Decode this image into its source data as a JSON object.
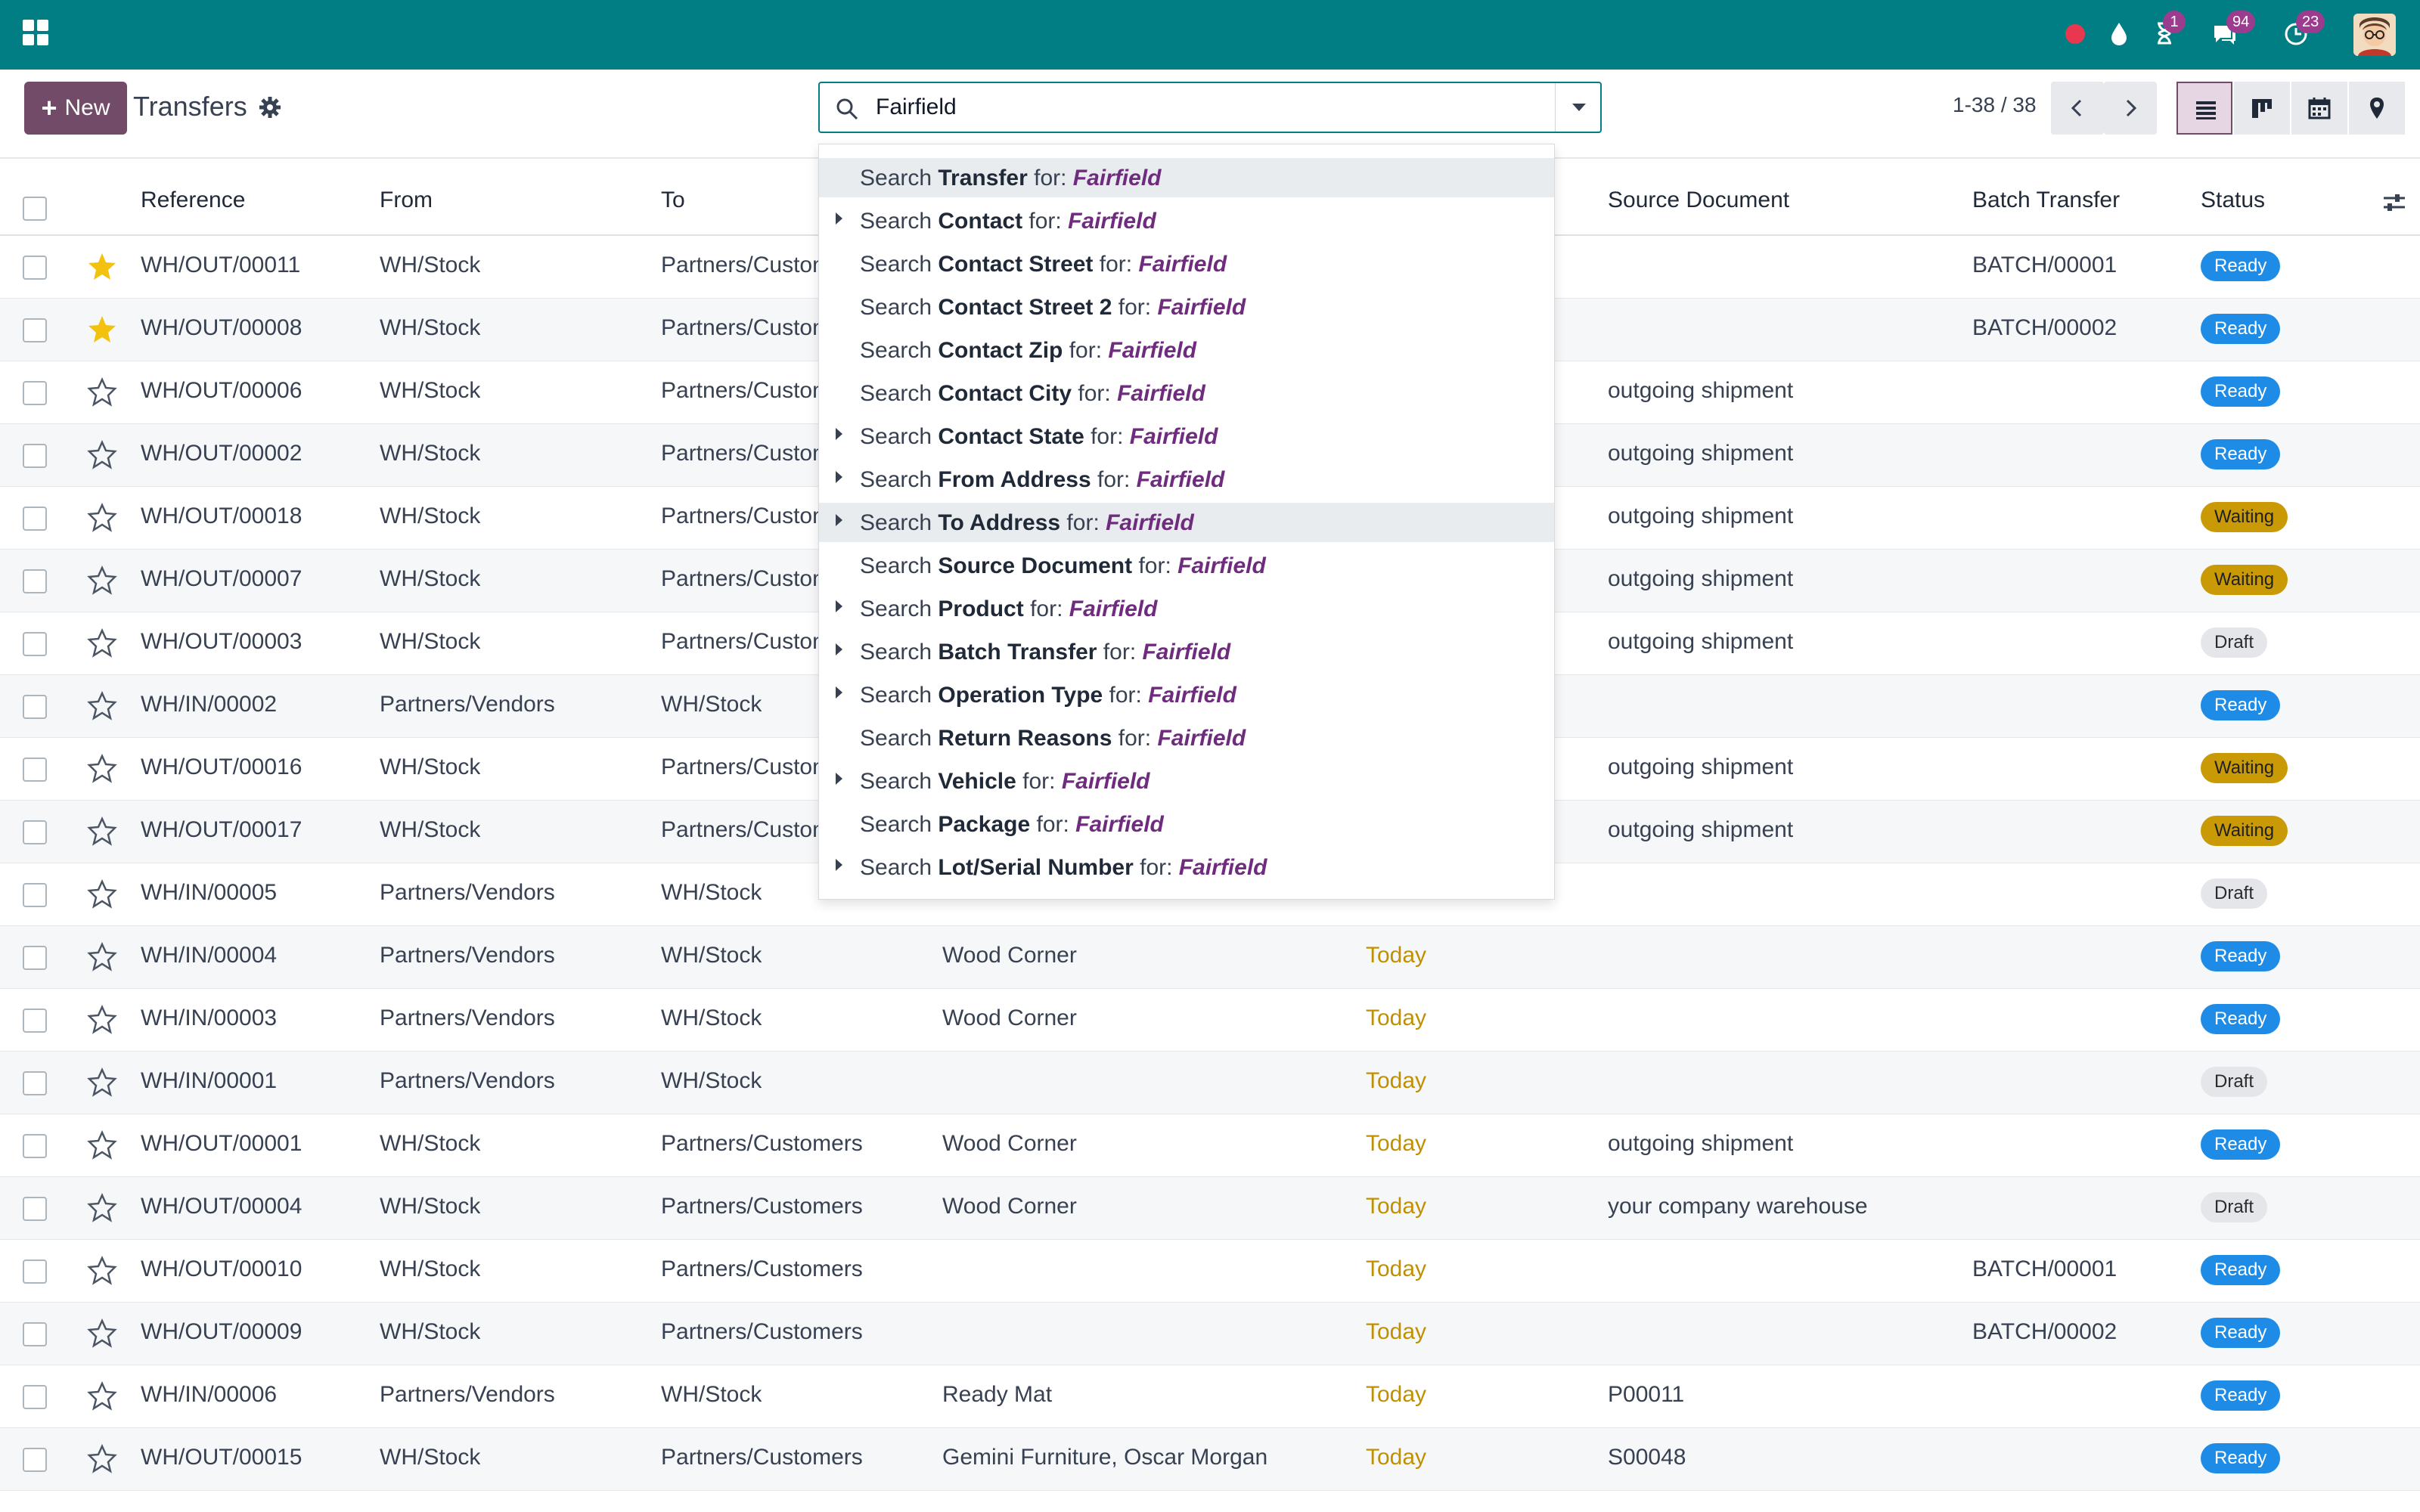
{
  "topbar": {
    "badges": {
      "activity": "1",
      "messages": "94",
      "updates": "23"
    },
    "icons": [
      "apps-icon",
      "recording-dot-icon",
      "drop-icon",
      "hourglass-icon",
      "chat-icon",
      "clock-icon",
      "avatar"
    ]
  },
  "control_panel": {
    "new_label": "New",
    "title": "Transfers",
    "search_value": "Fairfield",
    "pager": "1-38 / 38"
  },
  "list": {
    "headers": {
      "reference": "Reference",
      "from": "From",
      "to": "To",
      "source_document": "Source Document",
      "batch_transfer": "Batch Transfer",
      "status": "Status"
    },
    "rows": [
      {
        "ref": "WH/OUT/00011",
        "from": "WH/Stock",
        "to": "Partners/Customers",
        "contact": "",
        "scheduled": "",
        "source": "",
        "batch": "BATCH/00001",
        "status": "Ready",
        "starred": true
      },
      {
        "ref": "WH/OUT/00008",
        "from": "WH/Stock",
        "to": "Partners/Customers",
        "contact": "",
        "scheduled": "",
        "source": "",
        "batch": "BATCH/00002",
        "status": "Ready",
        "starred": true
      },
      {
        "ref": "WH/OUT/00006",
        "from": "WH/Stock",
        "to": "Partners/Customers",
        "contact": "",
        "scheduled": "",
        "source": "outgoing shipment",
        "batch": "",
        "status": "Ready",
        "starred": false
      },
      {
        "ref": "WH/OUT/00002",
        "from": "WH/Stock",
        "to": "Partners/Customers",
        "contact": "",
        "scheduled": "",
        "source": "outgoing shipment",
        "batch": "",
        "status": "Ready",
        "starred": false
      },
      {
        "ref": "WH/OUT/00018",
        "from": "WH/Stock",
        "to": "Partners/Customers",
        "contact": "",
        "scheduled": "",
        "source": "outgoing shipment",
        "batch": "",
        "status": "Waiting",
        "starred": false
      },
      {
        "ref": "WH/OUT/00007",
        "from": "WH/Stock",
        "to": "Partners/Customers",
        "contact": "",
        "scheduled": "",
        "source": "outgoing shipment",
        "batch": "",
        "status": "Waiting",
        "starred": false
      },
      {
        "ref": "WH/OUT/00003",
        "from": "WH/Stock",
        "to": "Partners/Customers",
        "contact": "",
        "scheduled": "",
        "source": "outgoing shipment",
        "batch": "",
        "status": "Draft",
        "starred": false
      },
      {
        "ref": "WH/IN/00002",
        "from": "Partners/Vendors",
        "to": "WH/Stock",
        "contact": "",
        "scheduled": "",
        "source": "",
        "batch": "",
        "status": "Ready",
        "starred": false
      },
      {
        "ref": "WH/OUT/00016",
        "from": "WH/Stock",
        "to": "Partners/Customers",
        "contact": "",
        "scheduled": "",
        "source": "outgoing shipment",
        "batch": "",
        "status": "Waiting",
        "starred": false
      },
      {
        "ref": "WH/OUT/00017",
        "from": "WH/Stock",
        "to": "Partners/Customers",
        "contact": "",
        "scheduled": "",
        "source": "outgoing shipment",
        "batch": "",
        "status": "Waiting",
        "starred": false
      },
      {
        "ref": "WH/IN/00005",
        "from": "Partners/Vendors",
        "to": "WH/Stock",
        "contact": "",
        "scheduled": "",
        "source": "",
        "batch": "",
        "status": "Draft",
        "starred": false
      },
      {
        "ref": "WH/IN/00004",
        "from": "Partners/Vendors",
        "to": "WH/Stock",
        "contact": "Wood Corner",
        "scheduled": "Today",
        "source": "",
        "batch": "",
        "status": "Ready",
        "starred": false
      },
      {
        "ref": "WH/IN/00003",
        "from": "Partners/Vendors",
        "to": "WH/Stock",
        "contact": "Wood Corner",
        "scheduled": "Today",
        "source": "",
        "batch": "",
        "status": "Ready",
        "starred": false
      },
      {
        "ref": "WH/IN/00001",
        "from": "Partners/Vendors",
        "to": "WH/Stock",
        "contact": "",
        "scheduled": "Today",
        "source": "",
        "batch": "",
        "status": "Draft",
        "starred": false
      },
      {
        "ref": "WH/OUT/00001",
        "from": "WH/Stock",
        "to": "Partners/Customers",
        "contact": "Wood Corner",
        "scheduled": "Today",
        "source": "outgoing shipment",
        "batch": "",
        "status": "Ready",
        "starred": false
      },
      {
        "ref": "WH/OUT/00004",
        "from": "WH/Stock",
        "to": "Partners/Customers",
        "contact": "Wood Corner",
        "scheduled": "Today",
        "source": "your company warehouse",
        "batch": "",
        "status": "Draft",
        "starred": false
      },
      {
        "ref": "WH/OUT/00010",
        "from": "WH/Stock",
        "to": "Partners/Customers",
        "contact": "",
        "scheduled": "Today",
        "source": "",
        "batch": "BATCH/00001",
        "status": "Ready",
        "starred": false
      },
      {
        "ref": "WH/OUT/00009",
        "from": "WH/Stock",
        "to": "Partners/Customers",
        "contact": "",
        "scheduled": "Today",
        "source": "",
        "batch": "BATCH/00002",
        "status": "Ready",
        "starred": false
      },
      {
        "ref": "WH/IN/00006",
        "from": "Partners/Vendors",
        "to": "WH/Stock",
        "contact": "Ready Mat",
        "scheduled": "Today",
        "source": "P00011",
        "batch": "",
        "status": "Ready",
        "starred": false
      },
      {
        "ref": "WH/OUT/00015",
        "from": "WH/Stock",
        "to": "Partners/Customers",
        "contact": "Gemini Furniture, Oscar Morgan",
        "scheduled": "Today",
        "source": "S00048",
        "batch": "",
        "status": "Ready",
        "starred": false
      }
    ]
  },
  "search_dropdown": {
    "prefix": "Search",
    "for_word": "for:",
    "value": "Fairfield",
    "items": [
      {
        "field": "Transfer",
        "expandable": false,
        "highlighted": true
      },
      {
        "field": "Contact",
        "expandable": true,
        "highlighted": false
      },
      {
        "field": "Contact Street",
        "expandable": false,
        "highlighted": false
      },
      {
        "field": "Contact Street 2",
        "expandable": false,
        "highlighted": false
      },
      {
        "field": "Contact Zip",
        "expandable": false,
        "highlighted": false
      },
      {
        "field": "Contact City",
        "expandable": false,
        "highlighted": false
      },
      {
        "field": "Contact State",
        "expandable": true,
        "highlighted": false
      },
      {
        "field": "From Address",
        "expandable": true,
        "highlighted": false
      },
      {
        "field": "To Address",
        "expandable": true,
        "highlighted": true
      },
      {
        "field": "Source Document",
        "expandable": false,
        "highlighted": false
      },
      {
        "field": "Product",
        "expandable": true,
        "highlighted": false
      },
      {
        "field": "Batch Transfer",
        "expandable": true,
        "highlighted": false
      },
      {
        "field": "Operation Type",
        "expandable": true,
        "highlighted": false
      },
      {
        "field": "Return Reasons",
        "expandable": false,
        "highlighted": false
      },
      {
        "field": "Vehicle",
        "expandable": true,
        "highlighted": false
      },
      {
        "field": "Package",
        "expandable": false,
        "highlighted": false
      },
      {
        "field": "Lot/Serial Number",
        "expandable": true,
        "highlighted": false
      }
    ]
  },
  "colors": {
    "topbar": "#017e84",
    "primary": "#714b67",
    "ready": "#1e8ce6",
    "waiting": "#c99a06",
    "draft": "#e4e6ea",
    "today": "#c09000"
  }
}
